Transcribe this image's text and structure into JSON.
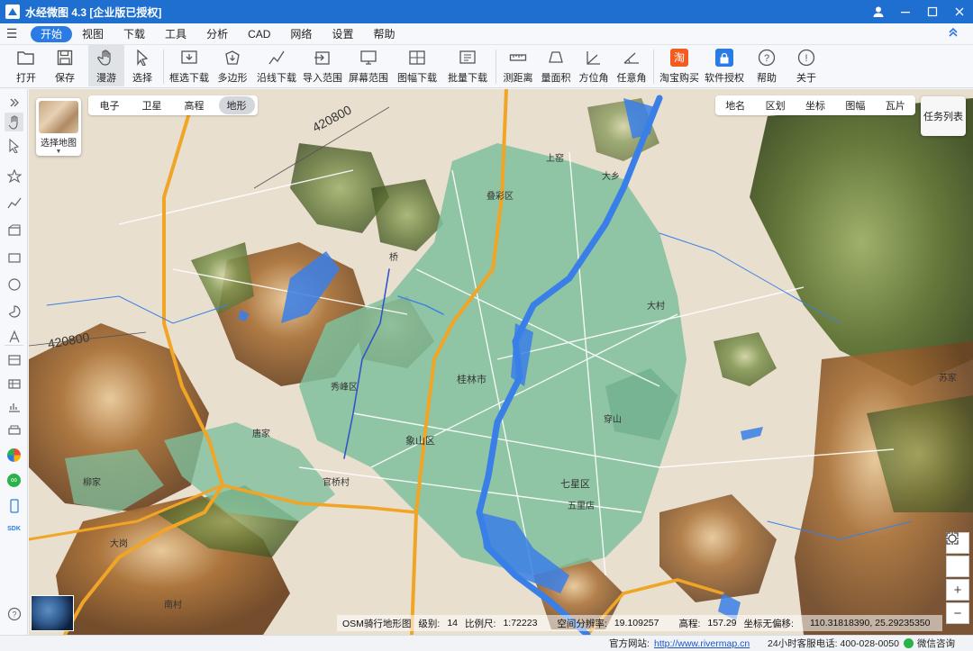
{
  "window": {
    "title": "水经微图 4.3 [企业版已授权]"
  },
  "menu": {
    "items": [
      "开始",
      "视图",
      "下载",
      "工具",
      "分析",
      "CAD",
      "网络",
      "设置",
      "帮助"
    ],
    "active_index": 0
  },
  "toolbar": {
    "tools": [
      {
        "label": "打开",
        "icon": "folder-icon",
        "dropdown": true
      },
      {
        "label": "保存",
        "icon": "save-icon"
      },
      {
        "label": "漫游",
        "icon": "hand-icon",
        "selected": true
      },
      {
        "label": "选择",
        "icon": "cursor-icon"
      },
      {
        "label": "框选下载",
        "icon": "box-download-icon"
      },
      {
        "label": "多边形",
        "icon": "polygon-download-icon"
      },
      {
        "label": "沿线下载",
        "icon": "line-download-icon"
      },
      {
        "label": "导入范围",
        "icon": "import-range-icon"
      },
      {
        "label": "屏幕范围",
        "icon": "screen-range-icon"
      },
      {
        "label": "图幅下载",
        "icon": "sheet-download-icon",
        "dropdown": true
      },
      {
        "label": "批量下载",
        "icon": "batch-download-icon"
      },
      {
        "label": "测距离",
        "icon": "ruler-icon"
      },
      {
        "label": "量面积",
        "icon": "area-icon"
      },
      {
        "label": "方位角",
        "icon": "azimuth-icon"
      },
      {
        "label": "任意角",
        "icon": "angle-icon"
      },
      {
        "label": "淘宝购买",
        "icon": "taobao-icon"
      },
      {
        "label": "软件授权",
        "icon": "license-icon"
      },
      {
        "label": "帮助",
        "icon": "help-icon"
      },
      {
        "label": "关于",
        "icon": "info-icon"
      }
    ]
  },
  "map": {
    "thumbnail_label": "选择地图",
    "layers": [
      "电子",
      "卫星",
      "高程",
      "地形"
    ],
    "active_layer": "地形",
    "overlays": [
      "地名",
      "区划",
      "坐标",
      "图幅",
      "瓦片"
    ],
    "task_button": "任务列表",
    "contour_labels": [
      "420800",
      "420800"
    ],
    "place_labels": [
      "桂林市",
      "象山区",
      "七星区",
      "秀峰区",
      "叠彩区",
      "桥",
      "大村",
      "唐家",
      "官桥村",
      "五里店",
      "大乡",
      "上窑",
      "穿山",
      "苏家",
      "大岗",
      "柳家",
      "南村"
    ],
    "status": {
      "source": "OSM骑行地形图",
      "level_label": "级别:",
      "level": "14",
      "scale_label": "比例尺:",
      "scale": "1:72223",
      "resolution_label": "空间分辨率:",
      "resolution": "19.109257",
      "elevation_label": "高程:",
      "elevation": "157.29",
      "coord_label": "坐标无偏移:",
      "coord": "110.31818390, 25.29235350"
    }
  },
  "footer": {
    "site_label": "官方网站:",
    "site_url": "http://www.rivermap.cn",
    "hotline": "24小时客服电话: 400-028-0050",
    "wechat": "微信咨询"
  },
  "colors": {
    "titlebar": "#1f6fd1",
    "accent": "#2a7be4",
    "urban": "#7fbf9c",
    "water": "#3a7fe8",
    "highway": "#f0a526",
    "terrain_base": "#e9dfcf",
    "hill_green": "#6f8f43",
    "hill_brown": "#8a5a2b"
  }
}
